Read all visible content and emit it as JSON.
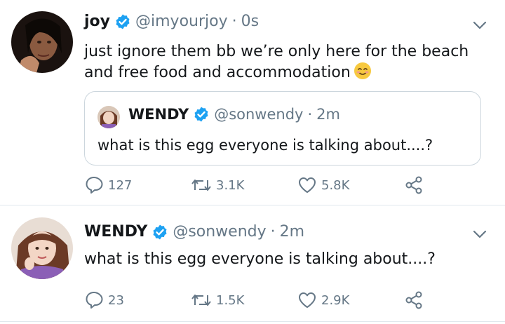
{
  "tweets": [
    {
      "name": "joy",
      "handle": "@imyourjoy",
      "time": "0s",
      "text_line1": "just ignore them bb we’re only here for the beach",
      "text_line2": "and free food and accommodation",
      "emoji": "smiling-face-with-smiling-eyes",
      "quote": {
        "name": "WENDY",
        "handle": "@sonwendy",
        "time": "2m",
        "text": "what is this egg everyone is talking about....?"
      },
      "actions": {
        "replies": "127",
        "retweets": "3.1K",
        "likes": "5.8K"
      }
    },
    {
      "name": "WENDY",
      "handle": "@sonwendy",
      "time": "2m",
      "text": "what is this egg everyone is talking about....?",
      "actions": {
        "replies": "23",
        "retweets": "1.5K",
        "likes": "2.9K"
      }
    }
  ],
  "separator": "·",
  "colors": {
    "verified": "#1da1f2",
    "secondary": "#657786",
    "border": "#e1e8ed"
  },
  "icons": [
    "verified-badge-icon",
    "chevron-down-icon",
    "reply-icon",
    "retweet-icon",
    "like-icon",
    "share-icon"
  ]
}
